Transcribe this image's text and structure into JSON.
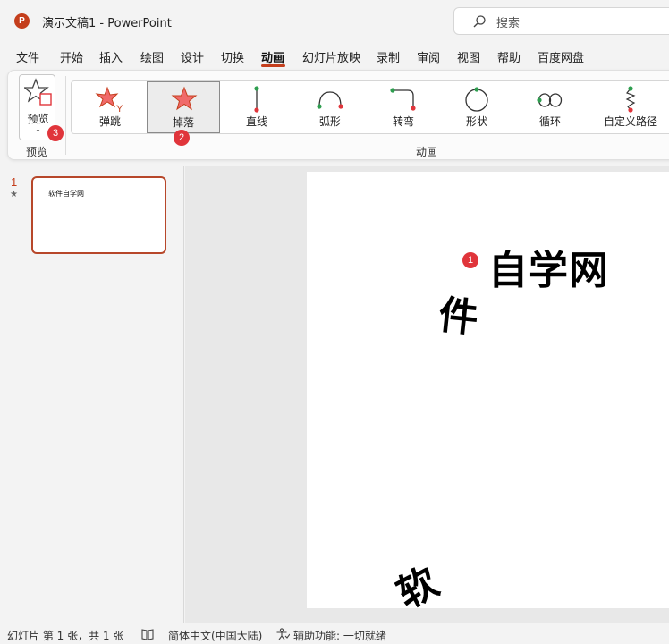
{
  "titlebar": {
    "logo": "P",
    "title": "演示文稿1  -  PowerPoint",
    "search_placeholder": "搜索"
  },
  "menu": {
    "tabs": [
      "文件",
      "开始",
      "插入",
      "绘图",
      "设计",
      "切换",
      "动画",
      "幻灯片放映",
      "录制",
      "审阅",
      "视图",
      "帮助",
      "百度网盘"
    ],
    "active": "动画"
  },
  "ribbon": {
    "preview_label": "预览",
    "preview_group_label": "预览",
    "animation_group_label": "动画",
    "animations": [
      {
        "label": "弹跳",
        "icon": "bounce-star-icon"
      },
      {
        "label": "掉落",
        "icon": "drop-star-icon",
        "selected": true
      },
      {
        "label": "直线",
        "icon": "line-path-icon"
      },
      {
        "label": "弧形",
        "icon": "arc-path-icon"
      },
      {
        "label": "转弯",
        "icon": "turn-path-icon"
      },
      {
        "label": "形状",
        "icon": "shape-path-icon"
      },
      {
        "label": "循环",
        "icon": "loop-path-icon"
      },
      {
        "label": "自定义路径",
        "icon": "custom-path-icon"
      }
    ],
    "badges": [
      "2",
      "3"
    ]
  },
  "thumbnails": {
    "slide_number": "1",
    "thumb_text": "软件自学网"
  },
  "slide": {
    "badge": "1",
    "title": "自学网",
    "fall_char_1": "件",
    "fall_char_2": "软"
  },
  "statusbar": {
    "slide_info": "幻灯片 第 1 张，共 1 张",
    "language": "简体中文(中国大陆)",
    "accessibility": "辅助功能: 一切就绪"
  },
  "colors": {
    "accent": "#c43e1c",
    "badge": "#e0353b",
    "thumb_border": "#b7472a"
  }
}
